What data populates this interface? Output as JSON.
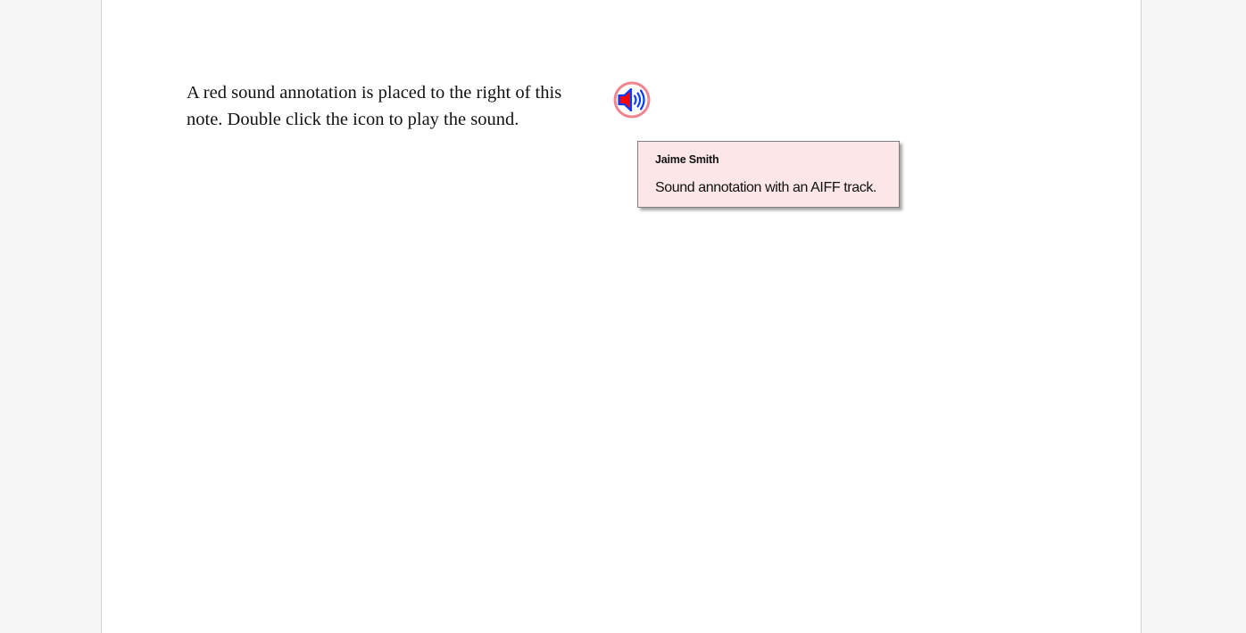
{
  "document": {
    "body_text": "A red sound annotation is placed to the right of this note. Double click the icon to play the sound."
  },
  "sound_annotation": {
    "icon": "speaker-icon",
    "fill_color": "#ff0000",
    "stroke_color": "#0a3cff",
    "halo_color": "#f0858f"
  },
  "popup_note": {
    "author": "Jaime Smith",
    "contents": "Sound annotation with an AIFF track.",
    "background_color": "#fde6e7"
  },
  "colors": {
    "viewer_background": "#f7f7f7",
    "page_background": "#ffffff"
  }
}
